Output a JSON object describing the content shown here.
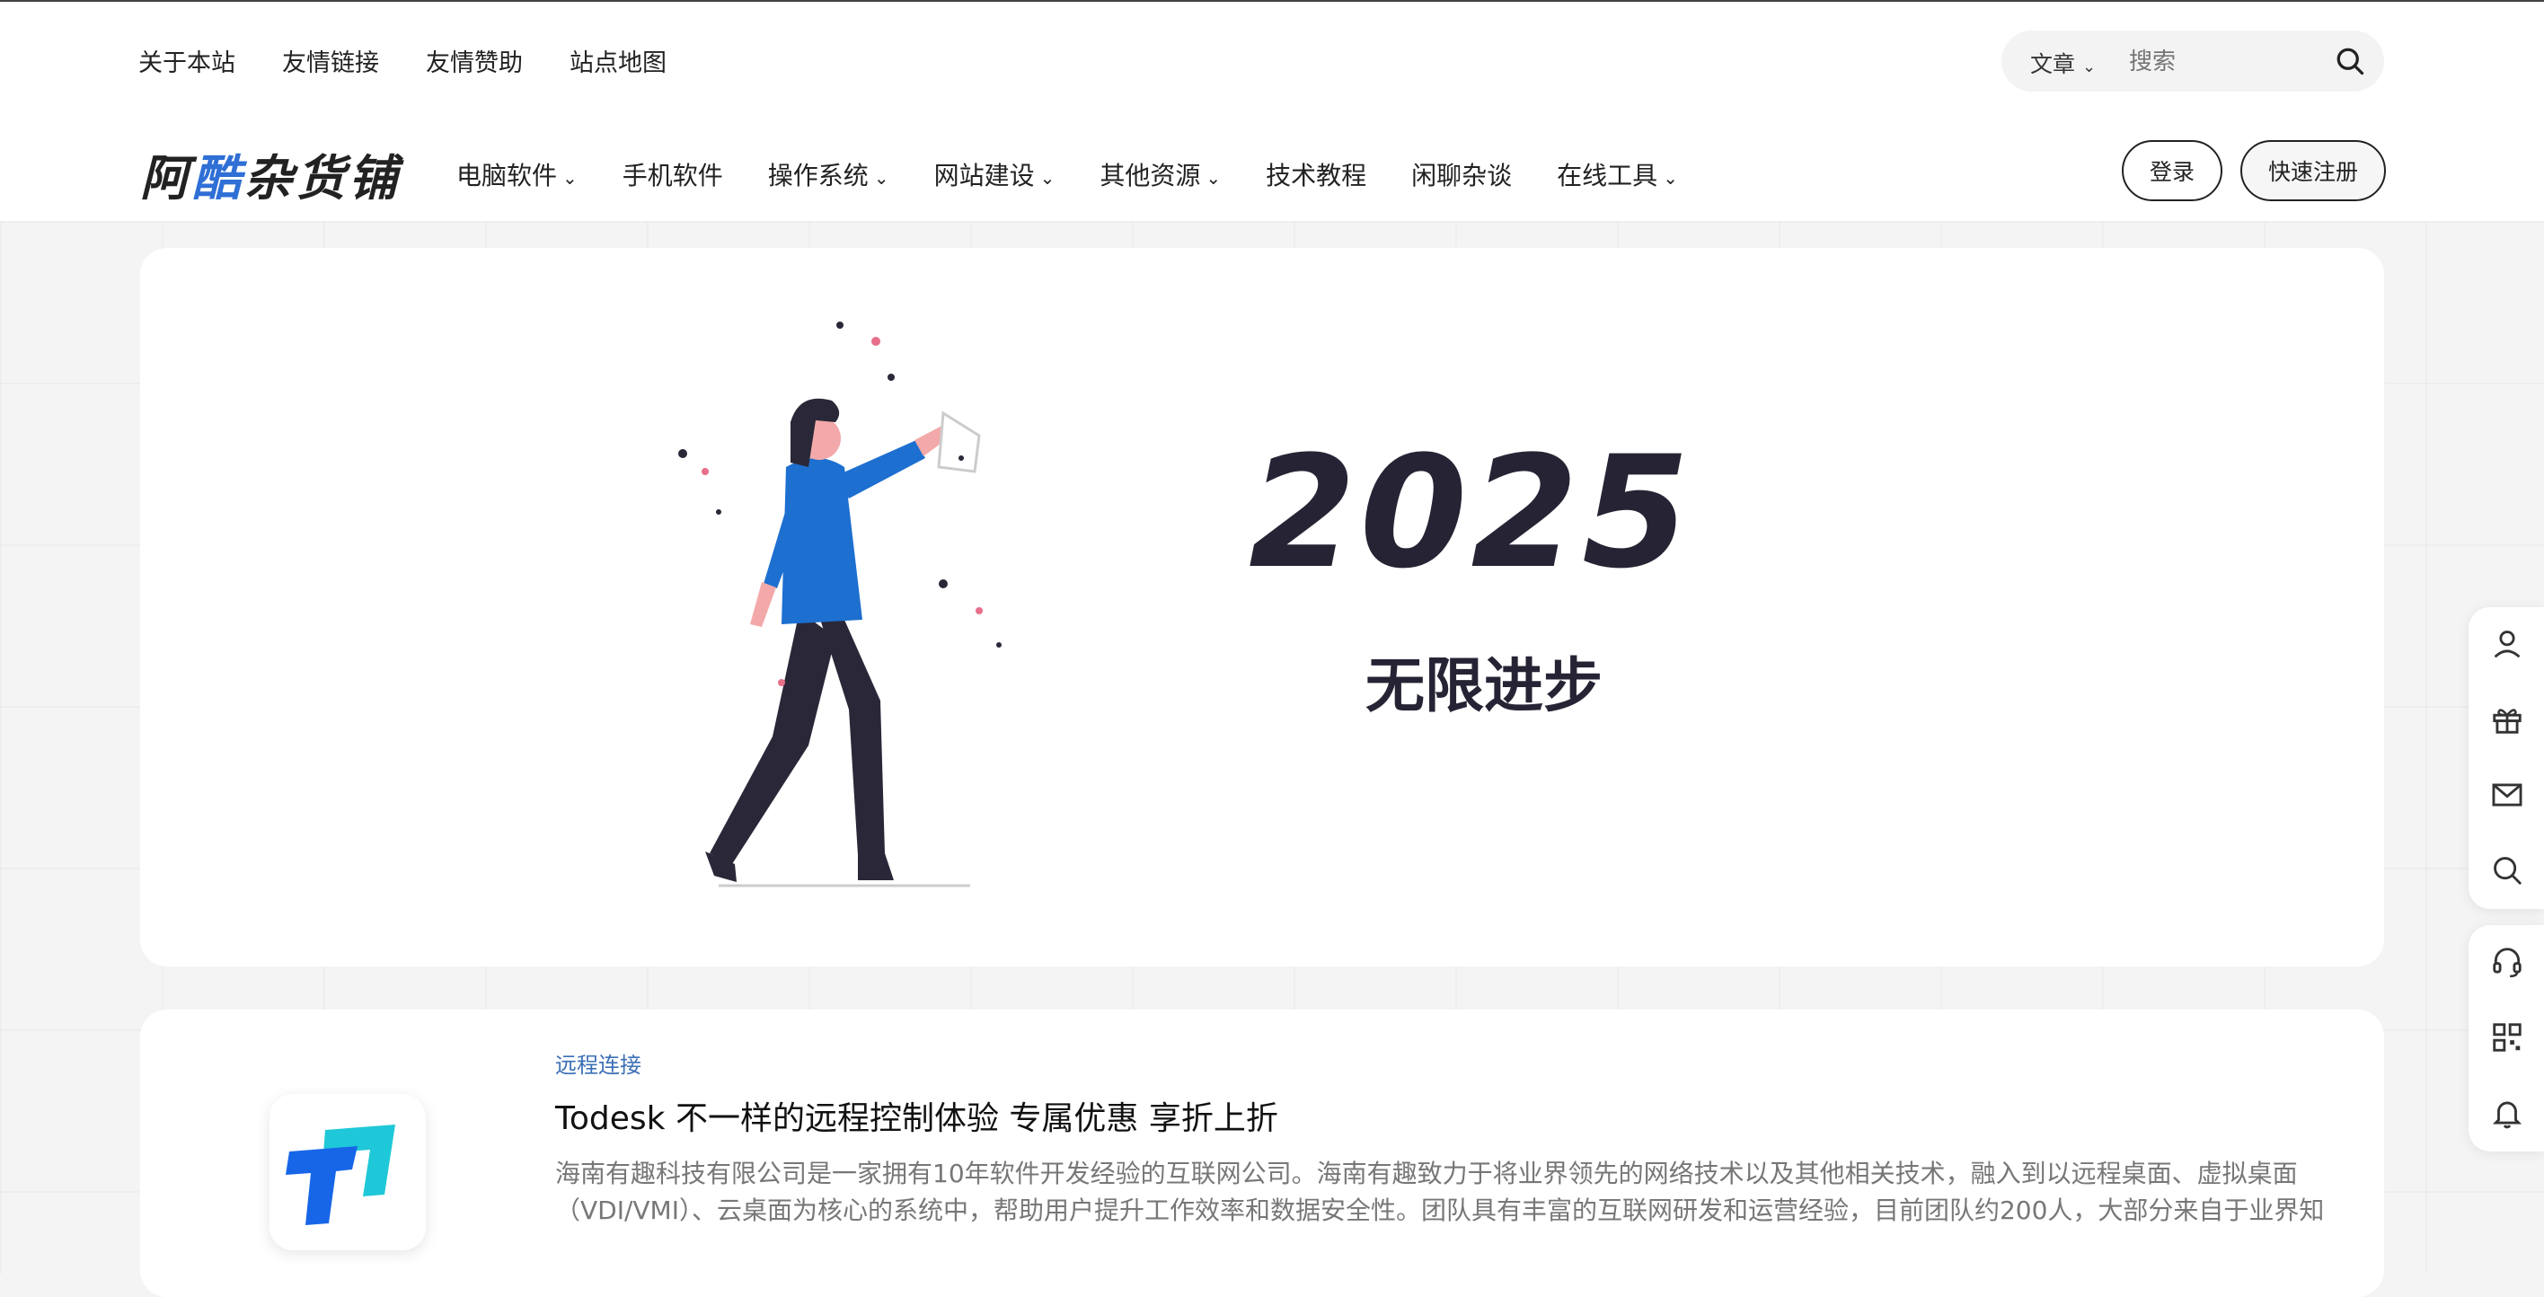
{
  "top_links": [
    "关于本站",
    "友情链接",
    "友情赞助",
    "站点地图"
  ],
  "search": {
    "scope": "文章",
    "placeholder": "搜索"
  },
  "logo": {
    "prefix": "阿",
    "highlight": "酷",
    "suffix": "杂货铺"
  },
  "nav": [
    {
      "label": "电脑软件",
      "dropdown": true
    },
    {
      "label": "手机软件",
      "dropdown": false
    },
    {
      "label": "操作系统",
      "dropdown": true
    },
    {
      "label": "网站建设",
      "dropdown": true
    },
    {
      "label": "其他资源",
      "dropdown": true
    },
    {
      "label": "技术教程",
      "dropdown": false
    },
    {
      "label": "闲聊杂谈",
      "dropdown": false
    },
    {
      "label": "在线工具",
      "dropdown": true
    }
  ],
  "auth": {
    "login": "登录",
    "register": "快速注册"
  },
  "banner": {
    "year": "2025",
    "slogan": "无限进步"
  },
  "article": {
    "category": "远程连接",
    "title": "Todesk 不一样的远程控制体验 专属优惠 享折上折",
    "excerpt": "海南有趣科技有限公司是一家拥有10年软件开发经验的互联网公司。海南有趣致力于将业界领先的网络技术以及其他相关技术，融入到以远程桌面、虚拟桌面（VDI/VMI）、云桌面为核心的系统中，帮助用户提升工作效率和数据安全性。团队具有丰富的互联网研发和运营经验，目前团队约200人，大部分来自于业界知名..."
  },
  "floating_tools": {
    "group1": [
      "user-icon",
      "gift-icon",
      "mail-icon",
      "search-icon"
    ],
    "group2": [
      "headset-icon",
      "qrcode-icon",
      "bell-icon"
    ]
  },
  "colors": {
    "accent": "#2f6fd6",
    "category": "#3b6fb6",
    "dark": "#262434"
  }
}
